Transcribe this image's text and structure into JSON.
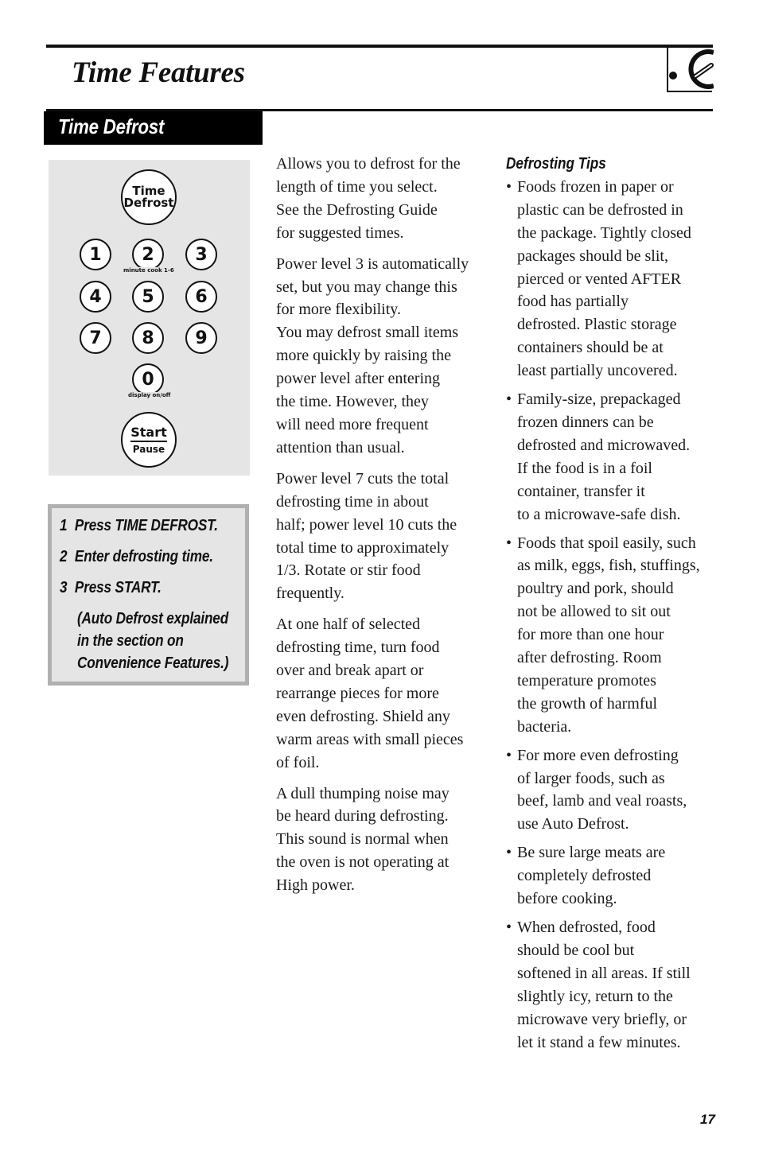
{
  "header": {
    "title": "Time Features",
    "logo_icon": "clock-dial-icon"
  },
  "section": {
    "title": "Time Defrost"
  },
  "keypad": {
    "time_defrost": {
      "line1": "Time",
      "line2": "Defrost"
    },
    "numbers": [
      "1",
      "2",
      "3",
      "4",
      "5",
      "6",
      "7",
      "8",
      "9",
      "0"
    ],
    "key2_sublabel": "minute cook 1-6",
    "key0_sublabel": "display on/off",
    "start": {
      "line1": "Start",
      "line2": "Pause"
    }
  },
  "steps": {
    "items": [
      {
        "number": "1",
        "text": "Press TIME DEFROST."
      },
      {
        "number": "2",
        "text": "Enter defrosting time."
      },
      {
        "number": "3",
        "text": "Press START."
      }
    ],
    "note_lines": [
      "(Auto Defrost explained",
      "in the section on",
      "Convenience Features.)"
    ]
  },
  "body": {
    "paragraphs": [
      "Allows you to defrost for the\nlength of time you select.\nSee the Defrosting Guide\nfor suggested times.",
      "Power level 3 is automatically\nset, but you may change this\nfor more flexibility.",
      "You may defrost small items\nmore quickly by raising the\npower level after entering\nthe time. However, they\nwill need more frequent\nattention than usual.",
      "Power level 7 cuts the total\ndefrosting time in about\nhalf; power level 10 cuts the\ntotal time to approximately\n1/3. Rotate or stir food\nfrequently.",
      "At one half of selected\ndefrosting time, turn food\nover and break apart or\nrearrange pieces for more\neven defrosting. Shield any\nwarm areas with small pieces\nof foil.",
      "A dull thumping noise may\nbe heard during defrosting.\nThis sound is normal when\nthe oven is not operating at\nHigh power."
    ]
  },
  "tips": {
    "title": "Defrosting Tips",
    "bullet": "•",
    "items": [
      "Foods frozen in paper or\nplastic can be defrosted in\nthe package. Tightly closed\npackages should be slit,\npierced or vented AFTER\nfood has partially\ndefrosted. Plastic storage\ncontainers should be at\nleast partially uncovered.",
      "Family-size, prepackaged\nfrozen dinners can be\ndefrosted and microwaved.\nIf the food is in a foil\ncontainer, transfer it\nto a microwave-safe dish.",
      "Foods that spoil easily, such\nas milk, eggs, fish, stuffings,\npoultry and pork, should\nnot be allowed to sit out\nfor more than one hour\nafter defrosting. Room\ntemperature promotes\nthe growth of harmful\nbacteria.",
      "For more even defrosting\nof larger foods, such as\nbeef, lamb and veal roasts,\nuse Auto Defrost.",
      "Be sure large meats are\ncompletely defrosted\nbefore cooking.",
      "When defrosted, food\nshould be cool but\nsoftened in all areas. If still\nslightly icy, return to the\nmicrowave very briefly, or\nlet it stand a few minutes."
    ]
  },
  "footer": {
    "page_number": "17"
  }
}
